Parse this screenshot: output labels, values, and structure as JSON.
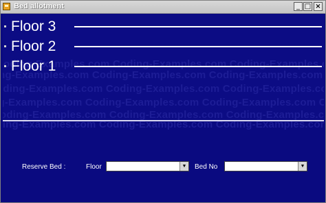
{
  "window": {
    "title": "Bed allotment",
    "minimize_glyph": "_",
    "maximize_glyph": "□",
    "close_glyph": "×"
  },
  "floors": [
    {
      "label": "Floor 3"
    },
    {
      "label": "Floor 2"
    },
    {
      "label": "Floor 1"
    }
  ],
  "watermark": {
    "text": "Coding-Examples.com Coding-Examples.com Coding-Examples.com Coding-Examples.com"
  },
  "reserve": {
    "label": "Reserve Bed :",
    "floor_label": "Floor",
    "floor_value": "",
    "bed_label": "Bed No",
    "bed_value": ""
  },
  "icons": {
    "app": "app-icon",
    "dropdown": "chevron-down-icon"
  },
  "colors": {
    "background": "#0a0a80",
    "text": "#ffffff",
    "watermark": "#1d1d96"
  }
}
